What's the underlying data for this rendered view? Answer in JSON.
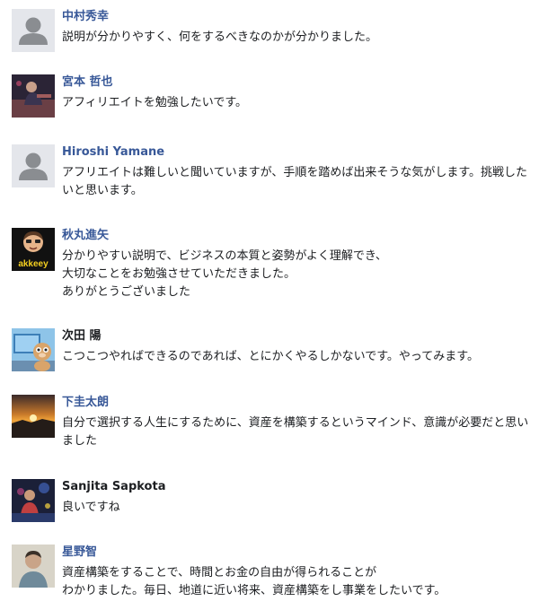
{
  "comments": [
    {
      "author": "中村秀幸",
      "avatar_icon": "default-profile-icon",
      "text": "説明が分かりやすく、何をするべきなのかが分かりました。"
    },
    {
      "author": "宮本 哲也",
      "avatar_icon": "profile-photo-icon",
      "text": "アフィリエイトを勉強したいです。"
    },
    {
      "author": "Hiroshi Yamane",
      "avatar_icon": "default-profile-icon",
      "text": "アフリエイトは難しいと聞いていますが、手順を踏めば出来そうな気がします。挑戦したいと思います。"
    },
    {
      "author": "秋丸進矢",
      "avatar_icon": "profile-photo-icon",
      "avatar_caption": "akkeey",
      "text": "分かりやすい説明で、ビジネスの本質と姿勢がよく理解でき、\n大切なことをお勉強させていただきました。\nありがとうございました"
    },
    {
      "author": "次田 陽",
      "avatar_icon": "profile-photo-icon",
      "text": "こつこつやればできるのであれば、とにかくやるしかないです。やってみます。"
    },
    {
      "author": "下圭太朗",
      "avatar_icon": "profile-photo-icon",
      "text": "自分で選択する人生にするために、資産を構築するというマインド、意識が必要だと思いました"
    },
    {
      "author": "Sanjita Sapkota",
      "avatar_icon": "profile-photo-icon",
      "text": "良いですね"
    },
    {
      "author": "星野智",
      "avatar_icon": "profile-photo-icon",
      "text": "資産構築をすることで、時間とお金の自由が得られることが\nわかりました。毎日、地道に近い将来、資産構築をし事業をしたいです。"
    }
  ],
  "colors": {
    "link_name": "#385898",
    "plain_name": "#1c1e21",
    "text": "#1c1e21",
    "default_avatar_bg": "#e4e6eb",
    "default_avatar_silhouette": "#8a8d91"
  }
}
